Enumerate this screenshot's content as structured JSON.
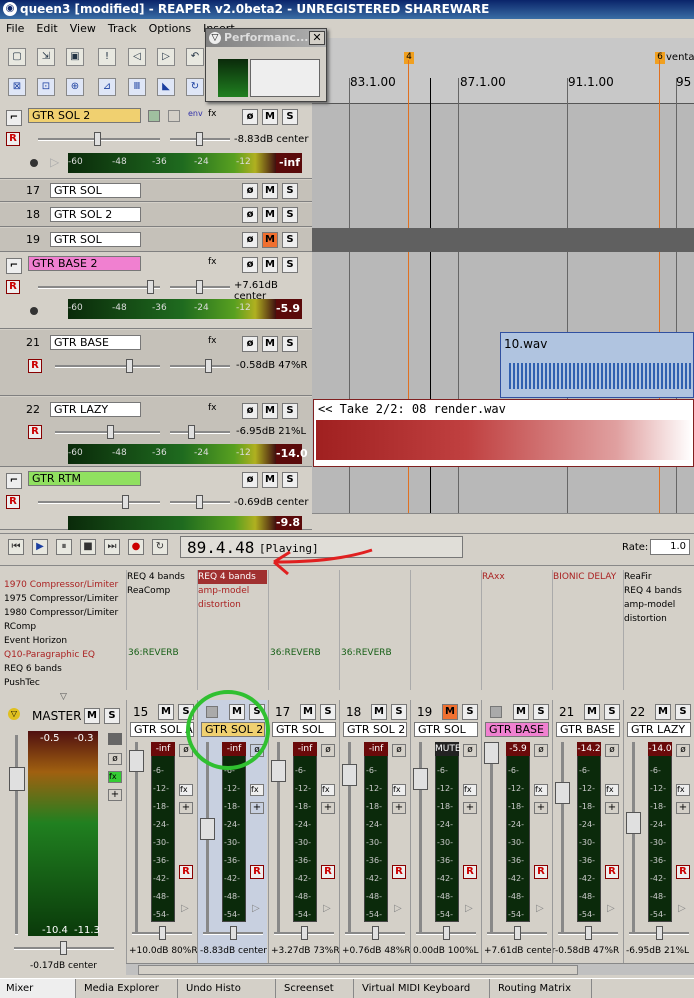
{
  "window": {
    "title": "queen3 [modified] - REAPER v2.0beta2 - UNREGISTERED SHAREWARE"
  },
  "menu": [
    "File",
    "Edit",
    "View",
    "Track",
    "Options",
    "Insert"
  ],
  "perf_window": {
    "title": "Performanc..."
  },
  "ruler": {
    "markers": [
      "4",
      "6"
    ],
    "marker_label": "venta",
    "times": [
      "83.1.00",
      "87.1.00",
      "91.1.00",
      "95"
    ]
  },
  "tracks": [
    {
      "num": "",
      "name": "GTR SOL 2",
      "color": "#f0d070",
      "vol": "-8.83dB center",
      "meter": "-inf"
    },
    {
      "num": "17",
      "name": "GTR SOL",
      "color": "#ffffff"
    },
    {
      "num": "18",
      "name": "GTR SOL  2",
      "color": "#ffffff"
    },
    {
      "num": "19",
      "name": "GTR SOL",
      "color": "#ffffff"
    },
    {
      "num": "",
      "name": "GTR BASE 2",
      "color": "#f080d0",
      "vol": "+7.61dB center",
      "meter": "-5.9"
    },
    {
      "num": "21",
      "name": "GTR BASE",
      "color": "#ffffff",
      "vol": "-0.58dB 47%R"
    },
    {
      "num": "22",
      "name": "GTR LAZY",
      "color": "#ffffff",
      "vol": "-6.95dB 21%L",
      "meter": "-14.0"
    },
    {
      "num": "",
      "name": "GTR RTM",
      "color": "#90e060",
      "vol": "-0.69dB center",
      "meter": "-9.8"
    }
  ],
  "meter_scale": [
    "-60",
    "-48",
    "-36",
    "-24",
    "-12"
  ],
  "button_labels": {
    "phase": "ø",
    "mute": "M",
    "solo": "S",
    "rec": "R",
    "fx": "fx",
    "env": "env"
  },
  "items": [
    {
      "label": "10.wav"
    },
    {
      "label": "<< Take 2/2: 08 render.wav"
    }
  ],
  "transport": {
    "time": "89.4.48",
    "status": "[Playing]",
    "rate_label": "Rate:",
    "rate": "1.0"
  },
  "fx_browser": [
    "1970 Compressor/Limiter",
    "1975 Compressor/Limiter",
    "1980 Compressor/Limiter",
    "RComp",
    "Event Horizon",
    "Q10-Paragraphic EQ",
    "REQ 6 bands",
    "PushTec"
  ],
  "fx_columns": [
    {
      "items": [
        "REQ 4 bands",
        "ReaComp"
      ],
      "send": "36:REVERB"
    },
    {
      "items": [
        "REQ 4 bands",
        "amp-model",
        "distortion"
      ],
      "send": ""
    },
    {
      "items": [],
      "send": "36:REVERB"
    },
    {
      "items": [],
      "send": "36:REVERB"
    },
    {
      "items": [],
      "send": ""
    },
    {
      "items": [
        "RAxx"
      ],
      "send": ""
    },
    {
      "items": [
        "BIONIC DELAY"
      ],
      "send": ""
    },
    {
      "items": [
        "ReaFir",
        "REQ 4 bands",
        "amp-model",
        "distortion"
      ],
      "send": ""
    }
  ],
  "master": {
    "label": "MASTER",
    "peaks": [
      "-0.5",
      "-0.3"
    ],
    "bottom": [
      "-10.4",
      "-11.3"
    ],
    "vol": "-0.17dB center"
  },
  "strips": [
    {
      "num": "15",
      "name": "GTR SOL A",
      "peak": "-inf",
      "vol": "+10.0dB 80%R",
      "color": "#ffffff"
    },
    {
      "num": "",
      "name": "GTR SOL 2",
      "peak": "-inf",
      "vol": "-8.83dB center",
      "color": "#f0d070"
    },
    {
      "num": "17",
      "name": "GTR SOL",
      "peak": "-inf",
      "vol": "+3.27dB 73%R",
      "color": "#ffffff"
    },
    {
      "num": "18",
      "name": "GTR SOL  2",
      "peak": "-inf",
      "vol": "+0.76dB 48%R",
      "color": "#ffffff"
    },
    {
      "num": "19",
      "name": "GTR SOL",
      "peak": "MUTE",
      "vol": "0.00dB 100%L",
      "color": "#ffffff"
    },
    {
      "num": "",
      "name": "GTR BASE 2",
      "peak": "-5.9",
      "vol": "+7.61dB center",
      "color": "#f080d0"
    },
    {
      "num": "21",
      "name": "GTR BASE",
      "peak": "-14.2",
      "vol": "-0.58dB 47%R",
      "color": "#ffffff"
    },
    {
      "num": "22",
      "name": "GTR LAZY",
      "peak": "-14.0",
      "vol": "-6.95dB 21%L",
      "color": "#ffffff"
    }
  ],
  "strip_scale": [
    "-6-",
    "-12-",
    "-18-",
    "-24-",
    "-30-",
    "-36-",
    "-42-",
    "-48-",
    "-54-"
  ],
  "master_scale": [
    "6",
    "0",
    "-6",
    "-12",
    "-18",
    "-24",
    "-30",
    "-36",
    "-42",
    "-48",
    "-54"
  ],
  "tabs": [
    "Mixer",
    "Media Explorer",
    "Undo Histo",
    "Screenset",
    "Virtual MIDI Keyboard",
    "Routing Matrix"
  ],
  "colors": {
    "annotation": "#e02020",
    "circle": "#30c030"
  }
}
